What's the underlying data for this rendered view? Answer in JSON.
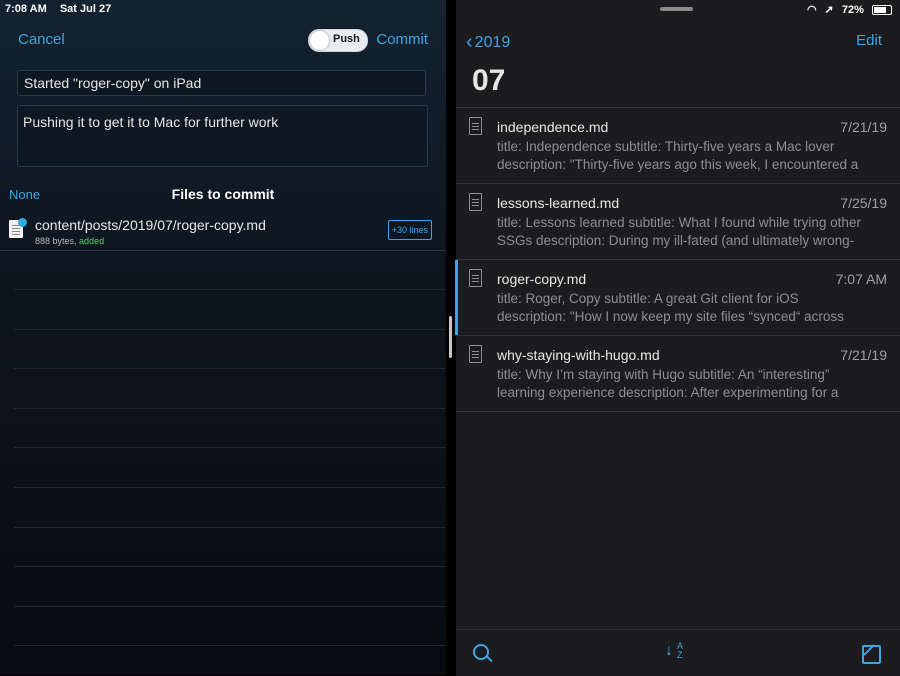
{
  "status_left": {
    "time": "7:08 AM",
    "date": "Sat Jul 27"
  },
  "status_right": {
    "battery": "72%"
  },
  "commit_sheet": {
    "cancel_label": "Cancel",
    "push_label": "Push",
    "push_on": false,
    "commit_label": "Commit",
    "title_value": "Started \"roger-copy\" on iPad",
    "description_value": "Pushing it to get it to Mac for further work",
    "none_label": "None",
    "files_title": "Files to commit",
    "files": [
      {
        "path": "content/posts/2019/07/roger-copy.md",
        "size": "888 bytes,",
        "state": "added",
        "lines": "+30 lines"
      }
    ]
  },
  "browser": {
    "back_label": "2019",
    "edit_label": "Edit",
    "folder_title": "07",
    "notes": [
      {
        "title": "independence.md",
        "date": "7/21/19",
        "line1": "title: Independence subtitle: Thirty-five years a Mac lover",
        "line2": "description: \"Thirty-five years ago this week, I encountered a"
      },
      {
        "title": "lessons-learned.md",
        "date": "7/25/19",
        "line1": "title: Lessons learned subtitle: What I found while trying other",
        "line2": "SSGs description: During my ill-fated (and ultimately wrong-"
      },
      {
        "title": "roger-copy.md",
        "date": "7:07 AM",
        "line1": "title: Roger, Copy subtitle: A great Git client for iOS",
        "line2": "description: \"How I now keep my site files “synced“ across"
      },
      {
        "title": "why-staying-with-hugo.md",
        "date": "7/21/19",
        "line1": "title: Why I’m staying with Hugo subtitle: An “interesting”",
        "line2": "learning experience description: After experimenting for a"
      }
    ],
    "toolbar": {
      "search_icon": "search-icon",
      "sort_icon": "sort-az-icon",
      "compose_icon": "compose-icon"
    }
  },
  "colors": {
    "accent": "#3fa4e6",
    "added": "#4cd964"
  }
}
